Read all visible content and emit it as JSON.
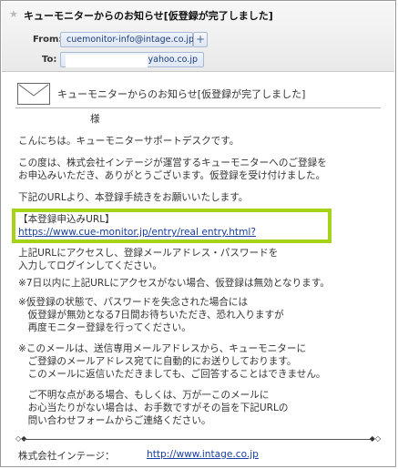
{
  "header": {
    "star_icon": "star-icon",
    "subject": "キューモニターからのお知らせ[仮登録が完了しました]",
    "from_label": "From:",
    "from_address": "cuemonitor-info@intage.co.jp",
    "add_contact": "+",
    "to_label": "To:",
    "to_address": "@yahoo.co.jp"
  },
  "message": {
    "envelope_icon": "envelope-icon",
    "notice_title": "キューモニターからのお知らせ[仮登録が完了しました]",
    "salutation": "様",
    "greeting": "こんにちは。キューモニターサポートデスクです。",
    "intro": "この度は、株式会社インテージが運営するキューモニターへのご登録を\nお申込みいただき、ありがとうございます。仮登録を受け付けました。",
    "instruction": "下記のURLより、本登録手続きをお願いいたします。",
    "url_label": "【本登録申込みURL】",
    "url": "https://www.cue-monitor.jp/entry/real entry.html?",
    "after_access": "上記URLにアクセスし、登録メールアドレス・パスワードを\n入力してログインしてください。",
    "note_7days": "※7日以内に上記URLにアクセスがない場合、仮登録は無効となります。",
    "note_password": "※仮登録の状態で、パスワードを失念された場合には\n　仮登録が無効となる7日間お待ちいただき、恐れ入りますが\n　再度モニター登録を行ってください。",
    "note_sendonly": "※このメールは、送信専用メールアドレスから、キューモニターに\n　ご登録のメールアドレス宛てに自動的にお送りしております。\n　このメールに返信いただきましても、ご回答することはできません。",
    "note_contact": "　ご不明な点がある場合、もしくは、万が一このメールに\n　お心当たりがない場合は、お手数ですがその旨を下記URLの\n　問い合わせフォームからご連絡ください。",
    "footer_company": "株式会社インテージ：",
    "footer_link": "http://www.intage.co.jp"
  },
  "colors": {
    "highlight": "#a6d316",
    "link": "#1a3fa0",
    "address_chip": "#dfe7f4"
  }
}
